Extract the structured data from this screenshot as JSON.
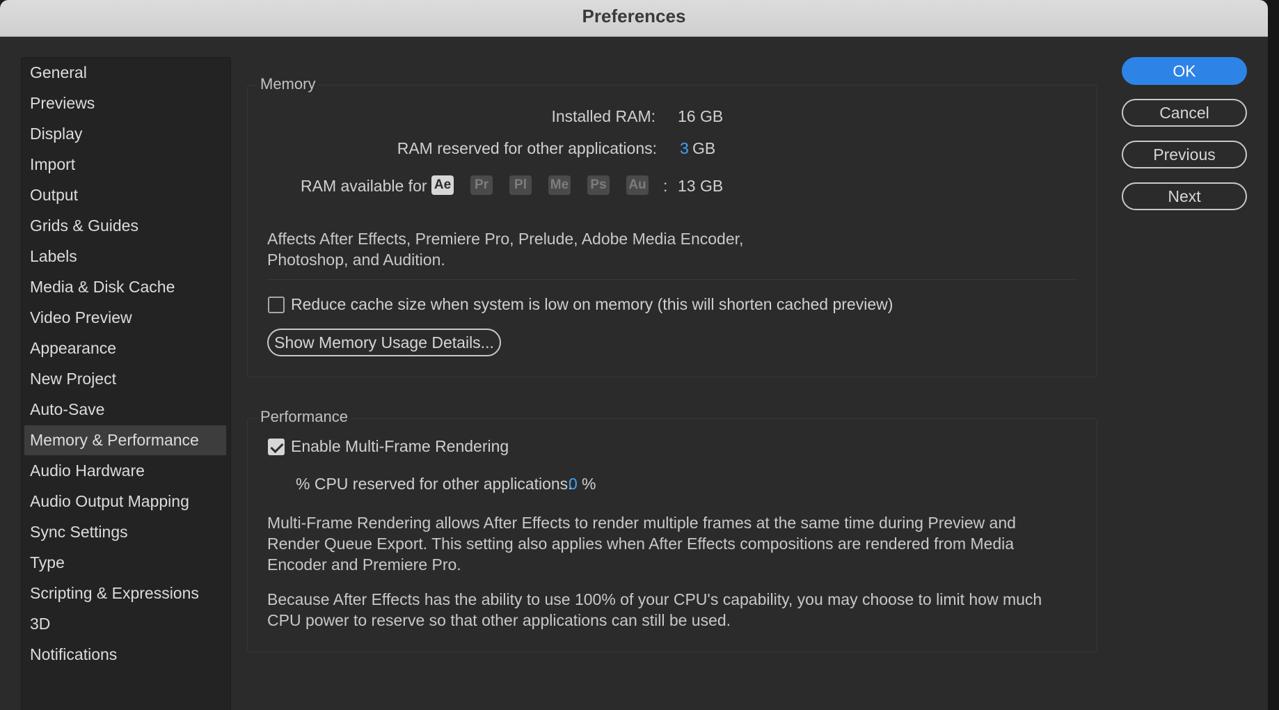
{
  "window": {
    "title": "Preferences"
  },
  "sidebar": {
    "items": [
      {
        "label": "General"
      },
      {
        "label": "Previews"
      },
      {
        "label": "Display"
      },
      {
        "label": "Import"
      },
      {
        "label": "Output"
      },
      {
        "label": "Grids & Guides"
      },
      {
        "label": "Labels"
      },
      {
        "label": "Media & Disk Cache"
      },
      {
        "label": "Video Preview"
      },
      {
        "label": "Appearance"
      },
      {
        "label": "New Project"
      },
      {
        "label": "Auto-Save"
      },
      {
        "label": "Memory & Performance",
        "selected": true
      },
      {
        "label": "Audio Hardware"
      },
      {
        "label": "Audio Output Mapping"
      },
      {
        "label": "Sync Settings"
      },
      {
        "label": "Type"
      },
      {
        "label": "Scripting & Expressions"
      },
      {
        "label": "3D"
      },
      {
        "label": "Notifications"
      }
    ]
  },
  "memory": {
    "title": "Memory",
    "installed_label": "Installed RAM:",
    "installed_value": "16 GB",
    "reserved_label": "RAM reserved for other applications:",
    "reserved_value": "3",
    "reserved_unit": "GB",
    "available_label": "RAM available for",
    "apps": [
      "Ae",
      "Pr",
      "Pl",
      "Me",
      "Ps",
      "Au"
    ],
    "active_app": "Ae",
    "available_sep": ":",
    "available_value": "13 GB",
    "affects_text": "Affects After Effects, Premiere Pro, Prelude, Adobe Media Encoder,\nPhotoshop, and Audition.",
    "reduce_cache_label": "Reduce cache size when system is low on memory (this will shorten cached preview)",
    "reduce_cache_checked": false,
    "details_button": "Show Memory Usage Details..."
  },
  "performance": {
    "title": "Performance",
    "mfr_label": "Enable Multi-Frame Rendering",
    "mfr_checked": true,
    "cpu_label": "% CPU reserved for other applications:",
    "cpu_value": "0",
    "cpu_unit": "%",
    "para1": "Multi-Frame Rendering allows After Effects to render multiple frames at the same time during Preview and\nRender Queue Export. This setting also applies when After Effects compositions are rendered from Media\nEncoder and Premiere Pro.",
    "para2": "Because After Effects has the ability to use 100% of your CPU's capability, you may choose to limit how much\nCPU power to reserve so that other applications can still be used."
  },
  "buttons": {
    "ok": "OK",
    "cancel": "Cancel",
    "previous": "Previous",
    "next": "Next"
  },
  "colors": {
    "accent": "#2d84e6",
    "value_blue": "#3ea3f7"
  }
}
